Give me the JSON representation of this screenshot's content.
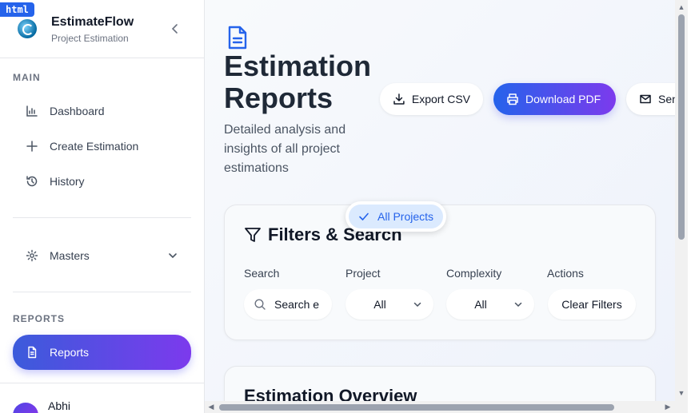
{
  "badge": "html",
  "brand": {
    "name": "EstimateFlow",
    "subtitle": "Project Estimation"
  },
  "sidebar": {
    "main_label": "MAIN",
    "main_items": [
      {
        "label": "Dashboard",
        "icon": "bar-chart-icon"
      },
      {
        "label": "Create Estimation",
        "icon": "plus-icon"
      },
      {
        "label": "History",
        "icon": "history-icon"
      }
    ],
    "masters": {
      "label": "Masters",
      "icon": "gear-icon"
    },
    "reports_label": "REPORTS",
    "reports_item": {
      "label": "Reports",
      "icon": "document-icon",
      "active": true
    },
    "user": {
      "name": "Abhi"
    }
  },
  "header": {
    "title": "Estimation Reports",
    "subtitle": "Detailed analysis and insights of all project estimations",
    "buttons": {
      "export": "Export CSV",
      "pdf": "Download PDF",
      "send": "Send"
    }
  },
  "filters": {
    "title": "Filters & Search",
    "search": {
      "label": "Search",
      "placeholder": "Search e"
    },
    "project": {
      "label": "Project",
      "value": "All"
    },
    "complexity": {
      "label": "Complexity",
      "value": "All"
    },
    "actions": {
      "label": "Actions",
      "clear": "Clear Filters"
    },
    "dropdown_option": "All Projects"
  },
  "overview": {
    "title": "Estimation Overview"
  },
  "colors": {
    "accent_start": "#2563eb",
    "accent_end": "#7c3aed",
    "selected_bg": "#dbeafe"
  }
}
